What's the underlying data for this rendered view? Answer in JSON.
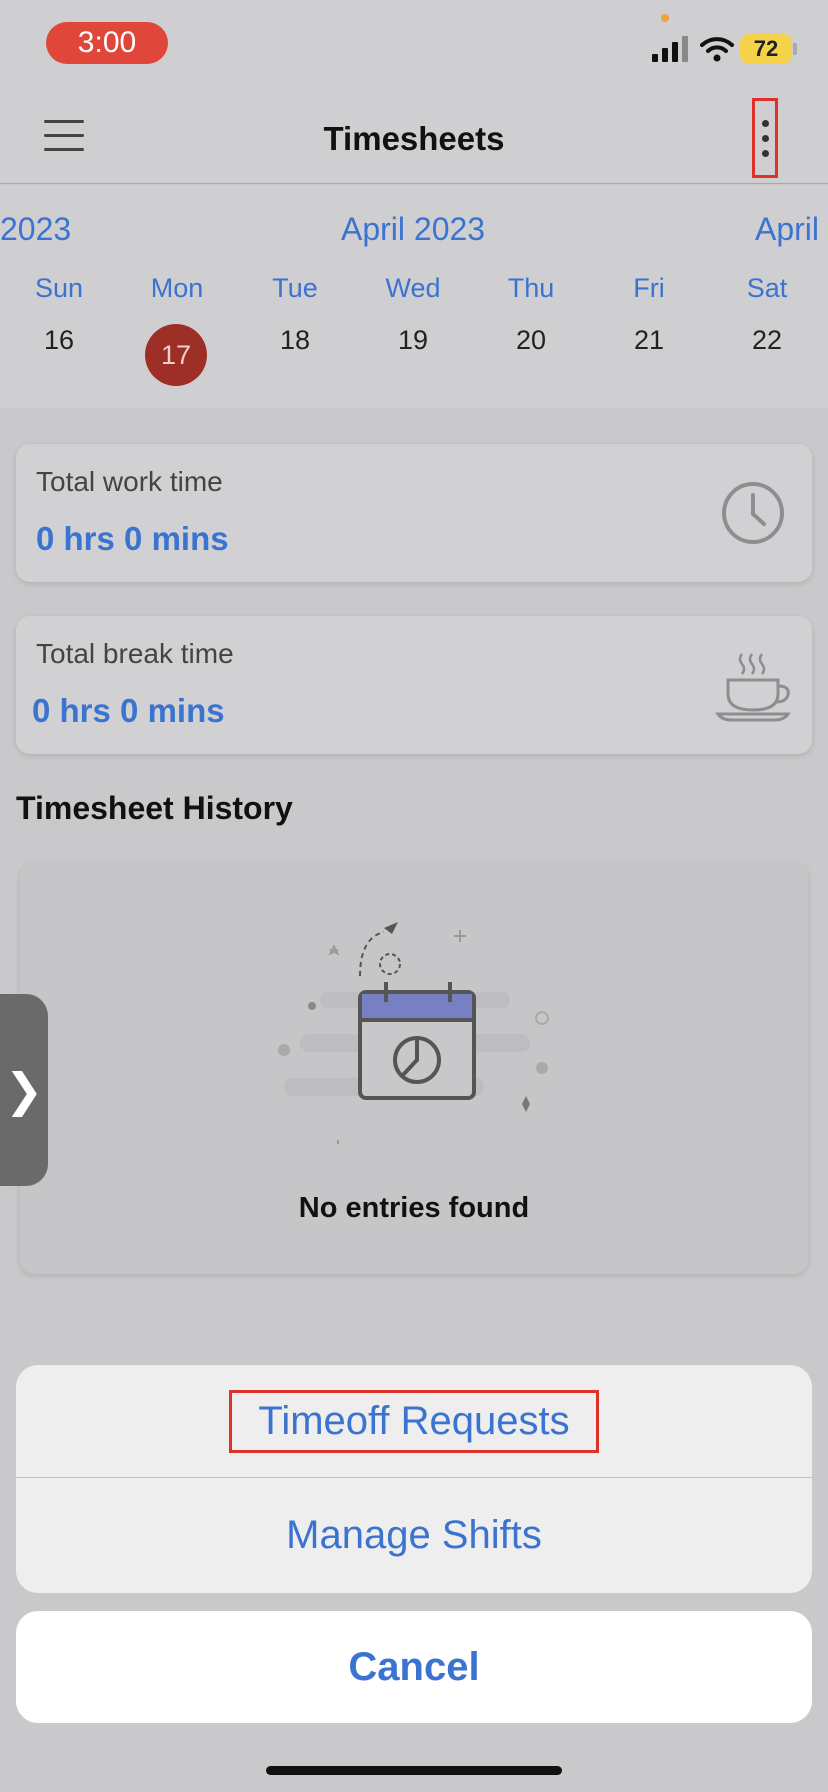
{
  "status_bar": {
    "time": "3:00",
    "battery": "72"
  },
  "header": {
    "title": "Timesheets"
  },
  "calendar": {
    "prev_month": "2023",
    "current_month": "April 2023",
    "next_month": "April",
    "weekdays": [
      "Sun",
      "Mon",
      "Tue",
      "Wed",
      "Thu",
      "Fri",
      "Sat"
    ],
    "days": [
      "16",
      "17",
      "18",
      "19",
      "20",
      "21",
      "22"
    ],
    "selected_day": "17"
  },
  "work_card": {
    "label": "Total work time",
    "value": "0 hrs 0 mins",
    "icon": "clock-icon"
  },
  "break_card": {
    "label": "Total break time",
    "value": "0 hrs 0 mins",
    "icon": "coffee-cup-icon"
  },
  "history": {
    "title": "Timesheet History",
    "empty_text": "No entries found"
  },
  "side_tab": {
    "glyph": "❯"
  },
  "action_sheet": {
    "items": [
      "Timeoff Requests",
      "Manage Shifts"
    ],
    "cancel": "Cancel"
  },
  "colors": {
    "accent": "#3b73d0",
    "selected_day": "#9e2f26",
    "highlight": "#e0302a",
    "time_pill": "#e0463a"
  }
}
